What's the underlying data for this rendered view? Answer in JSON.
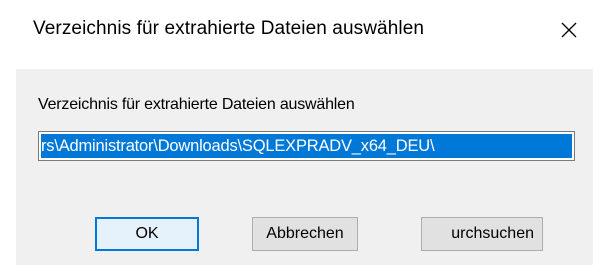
{
  "window": {
    "title": "Verzeichnis für extrahierte Dateien auswählen",
    "close_icon": "close-icon"
  },
  "prompt": {
    "label": "Verzeichnis für extrahierte Dateien auswählen"
  },
  "path_field": {
    "value": "rs\\Administrator\\Downloads\\SQLEXPRADV_x64_DEU\\",
    "selection_color": "#0078d7"
  },
  "buttons": {
    "ok_label": "OK",
    "cancel_label": "Abbrechen",
    "browse_label": "urchsuchen"
  }
}
